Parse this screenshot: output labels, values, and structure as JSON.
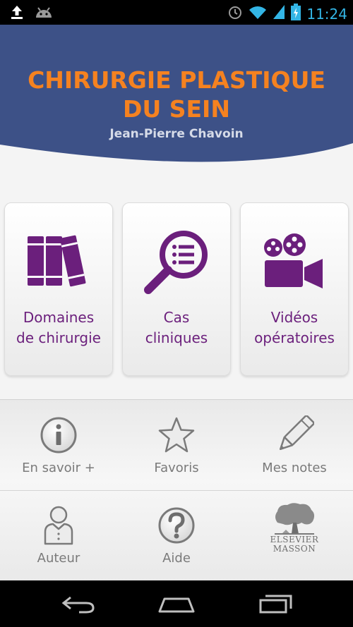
{
  "status_bar": {
    "time": "11:24",
    "left_icons": [
      "upload-icon",
      "android-icon"
    ],
    "right_icons": [
      "alarm-icon",
      "wifi-icon",
      "signal-icon",
      "battery-icon"
    ],
    "time_color": "#33b5e5"
  },
  "header": {
    "title_line1": "CHIRURGIE PLASTIQUE",
    "title_line2": "DU SEIN",
    "author": "Jean-Pierre Chavoin",
    "bg_color": "#3d5187",
    "title_color": "#f58220"
  },
  "cards": [
    {
      "line1": "Domaines",
      "line2": "de chirurgie",
      "icon": "books-icon"
    },
    {
      "line1": "Cas",
      "line2": "cliniques",
      "icon": "magnifier-list-icon"
    },
    {
      "line1": "Vidéos",
      "line2": "opératoires",
      "icon": "film-camera-icon"
    }
  ],
  "accent_color": "#6b1f7c",
  "menu": [
    {
      "label": "En savoir +",
      "icon": "info-icon"
    },
    {
      "label": "Favoris",
      "icon": "star-icon"
    },
    {
      "label": "Mes notes",
      "icon": "pencil-icon"
    },
    {
      "label": "Auteur",
      "icon": "person-icon"
    },
    {
      "label": "Aide",
      "icon": "help-icon"
    },
    {
      "label": "ELSEVIER MASSON",
      "icon": "elsevier-logo",
      "logo_line1": "ELSEVIER",
      "logo_line2": "MASSON"
    }
  ],
  "nav_bar": {
    "buttons": [
      "back-icon",
      "home-icon",
      "recent-apps-icon"
    ]
  }
}
